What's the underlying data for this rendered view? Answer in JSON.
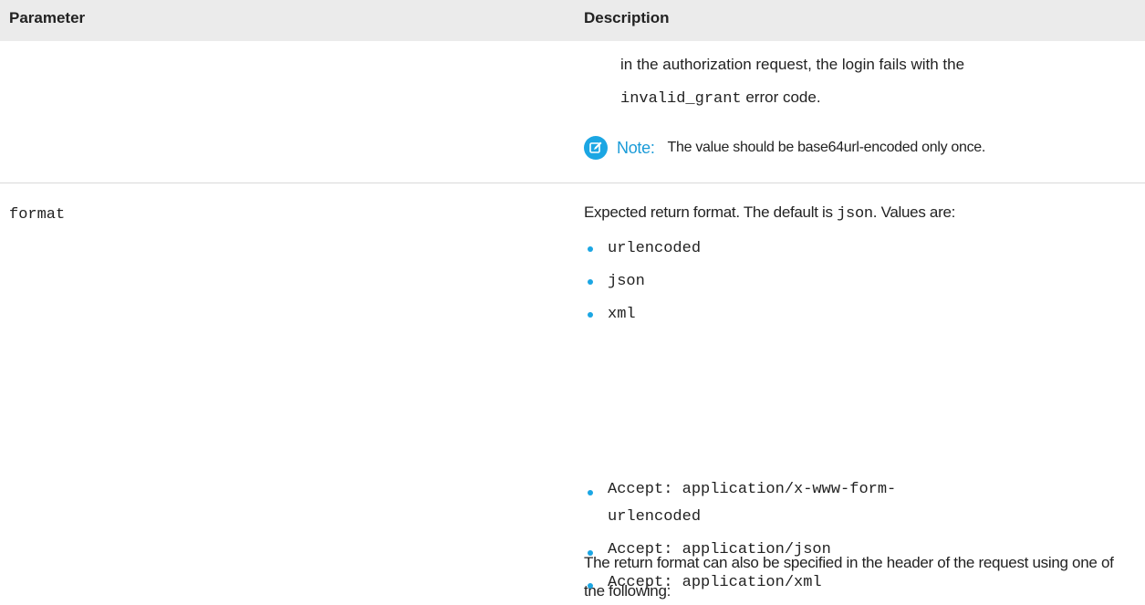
{
  "header": {
    "parameter": "Parameter",
    "description": "Description"
  },
  "row1": {
    "text_before": "in the authorization request, the login fails with the",
    "code": "invalid_grant",
    "text_after": " error code.",
    "note_label": "Note:",
    "note_text": "The value should be base64url-encoded only once.",
    "note_icon": "edit-note-icon",
    "accent_color": "#1ba6e3"
  },
  "row2": {
    "parameter": "format",
    "intro_before": "Expected return format. The default is ",
    "intro_code": "json",
    "intro_after": ". Values are:",
    "values": [
      "urlencoded",
      "json",
      "xml"
    ],
    "para": "The return format can also be specified in the header of the request using one of the following:",
    "headers": [
      "Accept: application/x-www-form-urlencoded",
      "Accept: application/json",
      "Accept: application/xml"
    ]
  }
}
